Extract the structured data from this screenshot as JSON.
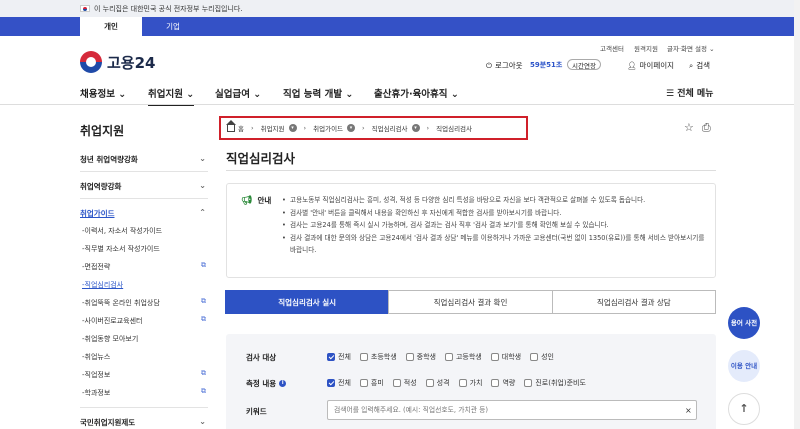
{
  "gov_banner": {
    "text": "이 누리집은 대한민국 공식 전자정부 누리집입니다."
  },
  "user_tabs": [
    {
      "label": "개인"
    },
    {
      "label": "기업"
    }
  ],
  "utility_links": [
    {
      "label": "고객센터"
    },
    {
      "label": "원격지원"
    },
    {
      "label": "글자·화면 설정 ⌄"
    }
  ],
  "logo": {
    "text": "고용24"
  },
  "header": {
    "logout": "로그아웃",
    "timer": "59분51초",
    "extend": "시간연장",
    "mypage": "마이페이지",
    "search": "검색"
  },
  "gnb": [
    {
      "label": "채용정보 ⌄"
    },
    {
      "label": "취업지원 ⌄"
    },
    {
      "label": "실업급여 ⌄"
    },
    {
      "label": "직업 능력 개발 ⌄"
    },
    {
      "label": "출산휴가·육아휴직 ⌄"
    }
  ],
  "all_menu": "전체 메뉴",
  "sidebar": {
    "title": "취업지원",
    "sections": [
      {
        "label": "청년 취업역량강화"
      },
      {
        "label": "취업역량강화"
      },
      {
        "label": "취업가이드"
      },
      {
        "label": "국민취업지원제도"
      }
    ],
    "sub_items": [
      {
        "label": "-이력서, 자소서 작성가이드"
      },
      {
        "label": "-직무별 자소서 작성가이드"
      },
      {
        "label": "-면접전략"
      },
      {
        "label": "-직업심리검사"
      },
      {
        "label": "-취업뚝뚝 온라인 취업상담"
      },
      {
        "label": "-사이버진로교육센터"
      },
      {
        "label": "-취업동향 모아보기"
      },
      {
        "label": "-취업뉴스"
      },
      {
        "label": "-직업정보"
      },
      {
        "label": "-학과정보"
      }
    ]
  },
  "breadcrumb": {
    "home": "홈",
    "items": [
      {
        "label": "취업지원"
      },
      {
        "label": "취업가이드"
      },
      {
        "label": "직업심리검사"
      },
      {
        "label": "직업심리검사"
      }
    ]
  },
  "page": {
    "title": "직업심리검사"
  },
  "notice": {
    "label": "안내",
    "items": [
      "고용노동부 직업심리검사는 흥미, 성격, 적성 등 다양한 심리 특성을 바탕으로 자신을 보다 객관적으로 살펴볼 수 있도록 돕습니다.",
      "검사별 '안내' 버튼을 클릭해서 내용을 확인하신 후 자신에게 적합한 검사를 받아보시기를 바랍니다.",
      "검사는 고용24를 통해 즉시 실시 가능하며, 검사 결과는 검사 직후 '검사 결과 보기'를 통해 확인해 보실 수 있습니다.",
      "검사 결과에 대한 문의와 상담은 고용24에서 '검사 결과 상담' 메뉴를 이용하거나 가까운 고용센터(국번 없이 1350(유료))를 통해 서비스 받아보시기를 바랍니다."
    ]
  },
  "tabs": [
    {
      "label": "직업심리검사 실시"
    },
    {
      "label": "직업심리검사 결과 확인"
    },
    {
      "label": "직업심리검사 결과 상담"
    }
  ],
  "filter": {
    "target_label": "검사 대상",
    "target_options": [
      "전체",
      "초등학생",
      "중학생",
      "고등학생",
      "대학생",
      "성인"
    ],
    "measure_label": "측정 내용",
    "measure_options": [
      "전체",
      "흥미",
      "적성",
      "성격",
      "가치",
      "역량",
      "진로(취업)준비도"
    ],
    "keyword_label": "키워드",
    "keyword_placeholder": "검색어를 입력해주세요. (예시: 직업선호도, 가치관 등)",
    "clear": "×"
  },
  "floating": {
    "dictionary": "용어 사전",
    "guide": "이용 안내",
    "top": "↑"
  },
  "colors": {
    "primary": "#2d52c4",
    "highlight_border": "#d0202a",
    "gov_bar": "#eef0f4"
  }
}
